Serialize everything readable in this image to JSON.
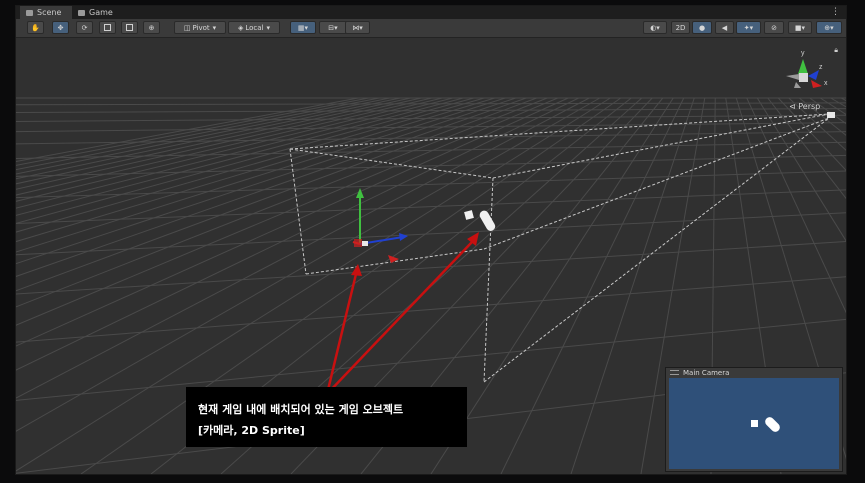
{
  "tabs": [
    {
      "label": "Scene",
      "icon": "scene-icon"
    },
    {
      "label": "Game",
      "icon": "game-icon"
    }
  ],
  "toolbar": {
    "pivot_label": "Pivot",
    "local_label": "Local",
    "mode_2d_label": "2D"
  },
  "scene": {
    "projection_label": "Persp",
    "gizmo_axes": {
      "y": "y",
      "z": "z",
      "x": "x"
    }
  },
  "callout": {
    "line1": "현재 게임 내에 배치되어 있는 게임 오브젝트",
    "line2": "[카메라, 2D Sprite]"
  },
  "camera_preview": {
    "title": "Main Camera"
  },
  "colors": {
    "scene_bg": "#303030",
    "arrow": "#c81010",
    "camera_bg": "#2f5079",
    "axis_x": "#d02020",
    "axis_y": "#40c040",
    "axis_z": "#2040d0"
  }
}
